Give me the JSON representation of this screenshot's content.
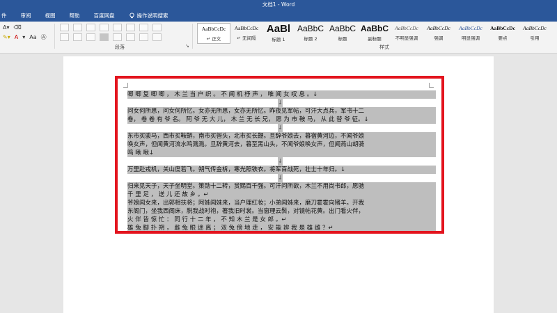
{
  "window": {
    "title": "文档1 - Word"
  },
  "menu": {
    "items": [
      "件",
      "审阅",
      "视图",
      "帮助",
      "百度网盘"
    ],
    "search_label": "操作说明搜索"
  },
  "ribbon": {
    "paragraph_group_label": "段落",
    "styles_group_label": "样式",
    "font_size_label": "A",
    "styles": [
      {
        "preview": "AaBbCcDc",
        "name": "↵ 正文"
      },
      {
        "preview": "AaBbCcDc",
        "name": "↵ 无间隔"
      },
      {
        "preview": "AaBl",
        "name": "标题 1"
      },
      {
        "preview": "AaBbC",
        "name": "标题 2"
      },
      {
        "preview": "AaBbC",
        "name": "标题"
      },
      {
        "preview": "AaBbC",
        "name": "副标题"
      },
      {
        "preview": "AaBbCcDc",
        "name": "不明显强调"
      },
      {
        "preview": "AaBbCcDc",
        "name": "强调"
      },
      {
        "preview": "AaBbCcDc",
        "name": "明显强调"
      },
      {
        "preview": "AaBbCcDc",
        "name": "要点"
      },
      {
        "preview": "AaBbCcDc",
        "name": "引用"
      }
    ]
  },
  "document": {
    "lines": [
      "唧 唧 复 唧 唧 ， 木 兰 当 户 织 。 不 闻 机 杼 声 ， 唯 闻 女 叹 息 。↓",
      "↓",
      "问女何所思，问女何所忆。女亦无所思，女亦无所忆。昨夜见军帖，可汗大点兵，军书十二",
      "卷， 卷 卷 有 爷 名。 阿 爷 无 大 儿， 木 兰 无 长 兄， 愿 为 市 鞍 马， 从 此 替 爷 征。↓",
      "↓",
      "东市买骏马，西市买鞍鞯，南市买辔头，北市买长鞭。旦辞爷娘去，暮宿黄河边，不闻爷娘",
      "唤女声，但闻黄河流水鸣溅溅。旦辞黄河去，暮至黑山头，不闻爷娘唤女声，但闻燕山胡骑",
      "鸣                                      啾                                                  啾↓",
      "↓",
      "万里赴戎机，关山度若飞。朔气传金柝，寒光照铁衣。将军百战死，壮士十年归。↓",
      "↓",
      "归来见天子，天子坐明堂。策勋十二转，赏赐百千强。可汗问所欲，木兰不用尚书郎，愿驰",
      "千    里          足   ，      送      儿      还      故      乡   。↵",
      "爷娘闻女来，出郭相扶将；阿姊闻妹来，当户理红妆；小弟闻姊来，磨刀霍霍向猪羊。开我",
      "东阁门，坐我西阁床，脱我战时袍，著我旧时裳。当窗理云鬓，对镜帖花黄。出门看火伴，",
      "火  伴  皆  惊  忙 ：  同  行  十  二  年  ，  不  知  木  兰  是  女  郎 。↵",
      "雄 兔 脚 扑 朔 ， 雌 兔 眼 迷 离 ； 双 兔 傍 地 走 ， 安 能 辨 我 是 雄 雌 ？↵"
    ]
  }
}
